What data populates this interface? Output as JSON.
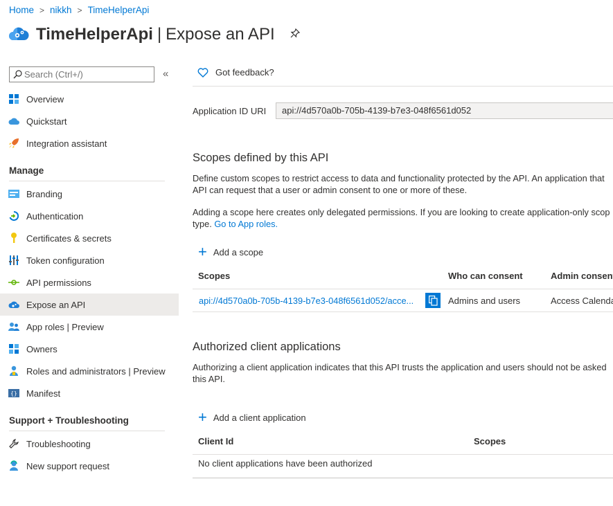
{
  "breadcrumb": {
    "items": [
      "Home",
      "nikkh",
      "TimeHelperApi"
    ],
    "separator": ">"
  },
  "title": {
    "app": "TimeHelperApi",
    "separator": "|",
    "page": "Expose an API"
  },
  "search": {
    "placeholder": "Search (Ctrl+/)"
  },
  "collapse": "«",
  "sidebar": {
    "items": [
      {
        "label": "Overview",
        "icon": "grid-icon"
      },
      {
        "label": "Quickstart",
        "icon": "cloud-icon"
      },
      {
        "label": "Integration assistant",
        "icon": "rocket-icon"
      }
    ],
    "manage_header": "Manage",
    "manage": [
      {
        "label": "Branding",
        "icon": "branding-icon"
      },
      {
        "label": "Authentication",
        "icon": "authentication-icon"
      },
      {
        "label": "Certificates & secrets",
        "icon": "key-icon"
      },
      {
        "label": "Token configuration",
        "icon": "token-icon"
      },
      {
        "label": "API permissions",
        "icon": "api-permissions-icon"
      },
      {
        "label": "Expose an API",
        "icon": "cloud-gear-icon",
        "active": true
      },
      {
        "label": "App roles | Preview",
        "icon": "users-icon"
      },
      {
        "label": "Owners",
        "icon": "owners-icon"
      },
      {
        "label": "Roles and administrators | Preview",
        "icon": "roles-icon"
      },
      {
        "label": "Manifest",
        "icon": "manifest-icon"
      }
    ],
    "support_header": "Support + Troubleshooting",
    "support": [
      {
        "label": "Troubleshooting",
        "icon": "wrench-icon"
      },
      {
        "label": "New support request",
        "icon": "support-person-icon"
      }
    ]
  },
  "main": {
    "feedback": "Got feedback?",
    "appid_label": "Application ID URI",
    "appid_value": "api://4d570a0b-705b-4139-b7e3-048f6561d052",
    "scopes_heading": "Scopes defined by this API",
    "scopes_desc_1": "Define custom scopes to restrict access to data and functionality protected by the API. An application that",
    "scopes_desc_2": "API can request that a user or admin consent to one or more of these.",
    "scopes_note_1": "Adding a scope here creates only delegated permissions. If you are looking to create application-only scop",
    "scopes_note_2a": "type.",
    "scopes_note_link": "Go to App roles.",
    "add_scope": "Add a scope",
    "scopes_table": {
      "headers": [
        "Scopes",
        "Who can consent",
        "Admin consent"
      ],
      "rows": [
        {
          "scope": "api://4d570a0b-705b-4139-b7e3-048f6561d052/acce...",
          "who": "Admins and users",
          "admin": "Access Calendar"
        }
      ]
    },
    "clients_heading": "Authorized client applications",
    "clients_desc_1": "Authorizing a client application indicates that this API trusts the application and users should not be asked",
    "clients_desc_2": "this API.",
    "add_client": "Add a client application",
    "clients_table": {
      "headers": [
        "Client Id",
        "Scopes"
      ],
      "empty": "No client applications have been authorized"
    }
  },
  "colors": {
    "accent": "#0078d4",
    "active_bg": "#edebe9",
    "divider": "#e1dfdd"
  }
}
